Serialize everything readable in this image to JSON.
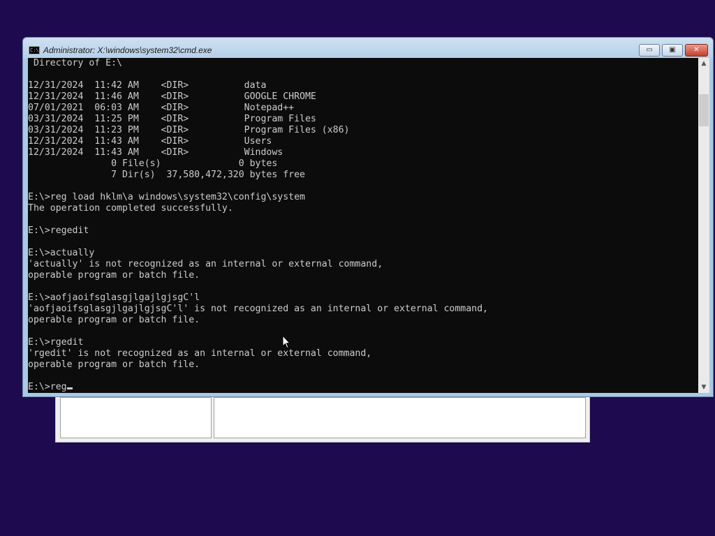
{
  "window": {
    "title": "Administrator: X:\\windows\\system32\\cmd.exe",
    "icon_text": "C:\\",
    "buttons": {
      "minimize": "▭",
      "maximize": "▣",
      "close": "✕"
    }
  },
  "console": {
    "text": " Directory of E:\\\n\n12/31/2024  11:42 AM    <DIR>          data\n12/31/2024  11:46 AM    <DIR>          GOOGLE CHROME\n07/01/2021  06:03 AM    <DIR>          Notepad++\n03/31/2024  11:25 PM    <DIR>          Program Files\n03/31/2024  11:23 PM    <DIR>          Program Files (x86)\n12/31/2024  11:43 AM    <DIR>          Users\n12/31/2024  11:43 AM    <DIR>          Windows\n               0 File(s)              0 bytes\n               7 Dir(s)  37,580,472,320 bytes free\n\nE:\\>reg load hklm\\a windows\\system32\\config\\system\nThe operation completed successfully.\n\nE:\\>regedit\n\nE:\\>actually\n'actually' is not recognized as an internal or external command,\noperable program or batch file.\n\nE:\\>aofjaoifsglasgjlgajlgjsgC'l\n'aofjaoifsglasgjlgajlgjsgC'l' is not recognized as an internal or external command,\noperable program or batch file.\n\nE:\\>rgedit\n'rgedit' is not recognized as an internal or external command,\noperable program or batch file.\n\n",
    "prompt_line": "E:\\>reg"
  },
  "scrollbar": {
    "up_arrow": "▲",
    "down_arrow": "▼"
  },
  "colors": {
    "desktop": "#1e0a4e",
    "console_bg": "#0c0c0c",
    "console_fg": "#cccccc",
    "titlebar": "#b5d0ea",
    "close_button": "#c7402b"
  }
}
